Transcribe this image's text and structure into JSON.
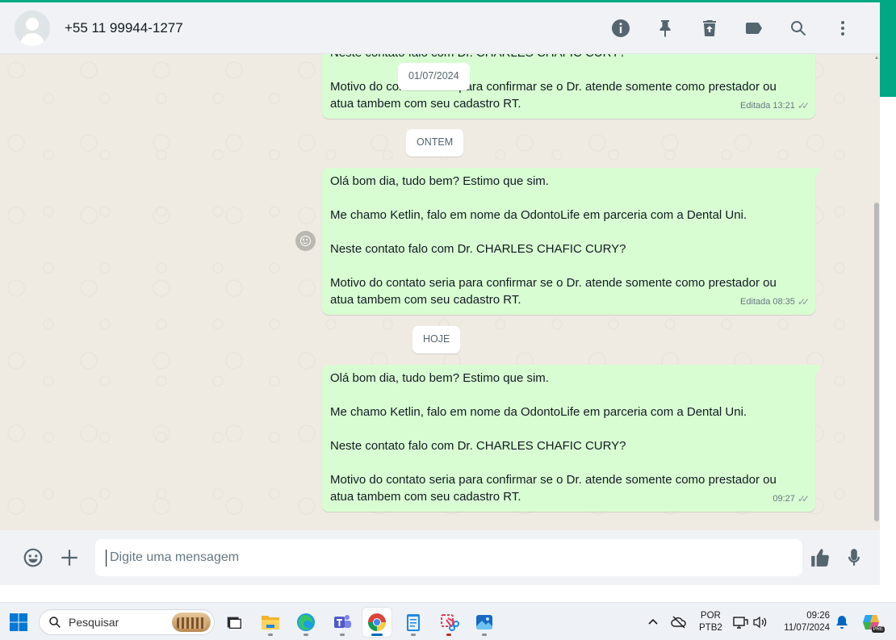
{
  "header": {
    "contact_name": "+55 11 99944-1277",
    "icons": [
      "info-icon",
      "pin-icon",
      "clear-chat-icon",
      "label-icon",
      "search-icon",
      "menu-icon"
    ]
  },
  "chat": {
    "date_labels": {
      "first": "01/07/2024",
      "second": "ONTEM",
      "third": "HOJE"
    },
    "messages": [
      {
        "partial_top_line": "Neste contato falo com Dr. CHARLES CHAFIC CURY?",
        "lines": [
          "Motivo do contato seria para confirmar se o Dr. atende somente como prestador ou atua tambem com seu cadastro RT."
        ],
        "status": "Editada",
        "time": "13:21"
      },
      {
        "lines": [
          "Olá bom dia, tudo bem? Estimo que sim.",
          "Me chamo Ketlin, falo em nome da OdontoLife em parceria com a Dental Uni.",
          "Neste contato falo com Dr. CHARLES CHAFIC CURY?",
          "Motivo do contato seria para confirmar se o Dr. atende somente como prestador ou atua tambem com seu cadastro RT."
        ],
        "status": "Editada",
        "time": "08:35"
      },
      {
        "lines": [
          "Olá bom dia, tudo bem? Estimo que sim.",
          "Me chamo Ketlin, falo em nome da OdontoLife em parceria com a Dental Uni.",
          "Neste contato falo com Dr. CHARLES CHAFIC CURY?",
          "Motivo do contato seria para confirmar se o Dr. atende somente como prestador ou atua tambem com seu cadastro RT."
        ],
        "status": "",
        "time": "09:27"
      }
    ]
  },
  "composer": {
    "placeholder": "Digite uma mensagem"
  },
  "taskbar": {
    "search_label": "Pesquisar",
    "language_line1": "POR",
    "language_line2": "PTB2",
    "time": "09:26",
    "date": "11/07/2024",
    "copilot_badge": "PRE"
  },
  "colors": {
    "accent": "#00a884",
    "outgoing_bubble": "#d9fdd3",
    "chat_background": "#efeae2",
    "header_background": "#f0f2f5"
  }
}
